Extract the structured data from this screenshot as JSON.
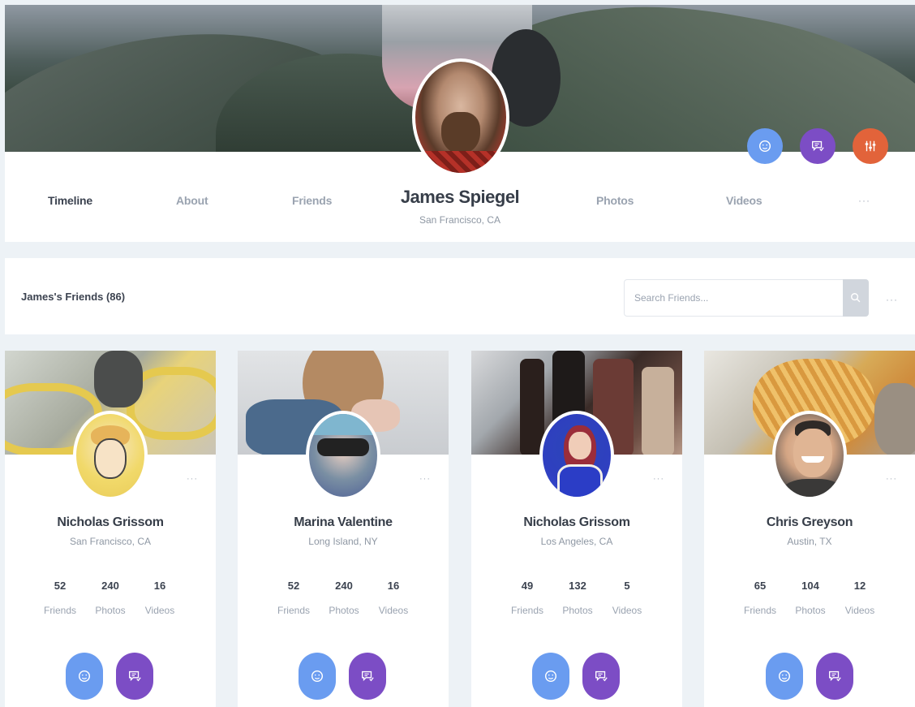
{
  "profile": {
    "name": "James Spiegel",
    "location": "San Francisco, CA",
    "actions": [
      {
        "name": "add-friend-icon",
        "color": "#6a9cf0"
      },
      {
        "name": "message-icon",
        "color": "#7c4dc5"
      },
      {
        "name": "settings-sliders-icon",
        "color": "#e2633a"
      }
    ]
  },
  "nav": {
    "items": [
      "Timeline",
      "About",
      "Friends",
      "Photos",
      "Videos"
    ],
    "more": "···"
  },
  "friends_section": {
    "title": "James's Friends (86)",
    "search_placeholder": "Search Friends...",
    "search_icon": "search-icon",
    "more": "···"
  },
  "stat_labels": [
    "Friends",
    "Photos",
    "Videos"
  ],
  "friends": [
    {
      "name": "Nicholas Grissom",
      "location": "San Francisco, CA",
      "friends": "52",
      "photos": "240",
      "videos": "16"
    },
    {
      "name": "Marina Valentine",
      "location": "Long Island, NY",
      "friends": "52",
      "photos": "240",
      "videos": "16"
    },
    {
      "name": "Nicholas Grissom",
      "location": "Los Angeles, CA",
      "friends": "49",
      "photos": "132",
      "videos": "5"
    },
    {
      "name": "Chris Greyson",
      "location": "Austin, TX",
      "friends": "65",
      "photos": "104",
      "videos": "12"
    }
  ],
  "card_more": "···"
}
